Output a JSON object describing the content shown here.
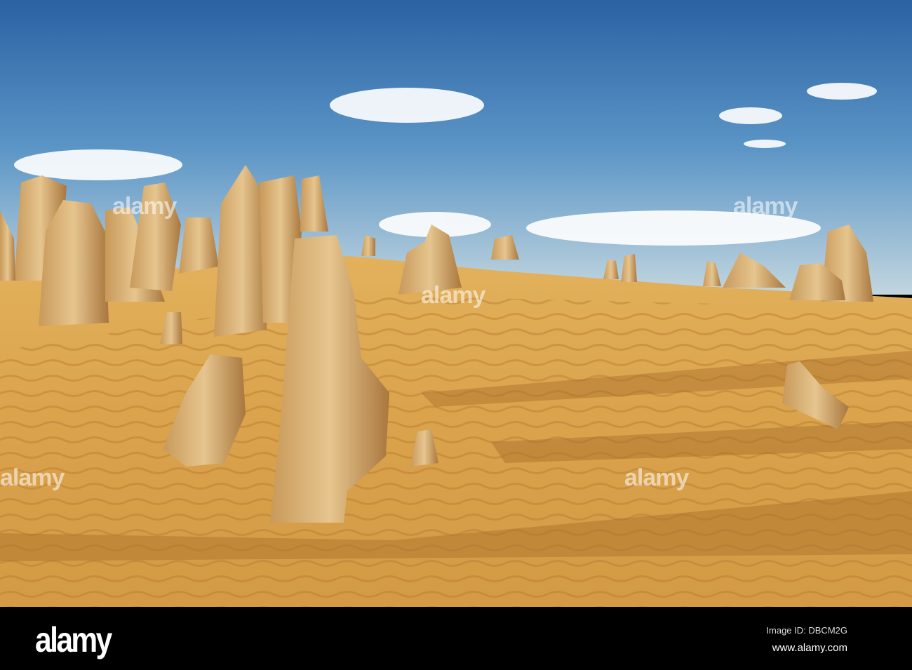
{
  "watermark": {
    "text": "alamy"
  },
  "footer": {
    "logo": "alamy",
    "image_id": "Image ID: DBCM2G",
    "website": "www.alamy.com"
  },
  "colors": {
    "sky_top": "#2a62a3",
    "sky_horizon": "#b8d0de",
    "sand_light": "#e0ac55",
    "sand_dark": "#b77a2e",
    "rock": "#d9b173"
  }
}
